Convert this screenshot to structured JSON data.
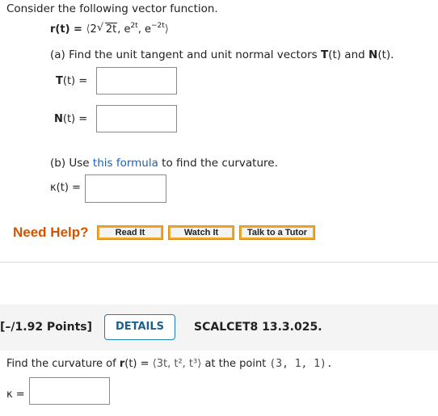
{
  "intro": "Consider the following vector function.",
  "vector_function": {
    "lhs": "r(t) = ",
    "open": "⟨",
    "coef": "2",
    "radical": "√",
    "radicand": "2t",
    "after_sqrt": ", e",
    "exp1": "2t",
    "sep": ", e",
    "exp2": "−2t",
    "close": "⟩"
  },
  "part_a": {
    "prefix": "(a) Find the unit tangent and unit normal vectors ",
    "T": "T",
    "T_arg": "(t)",
    "and": " and ",
    "N": "N",
    "N_arg": "(t)",
    "end": ".",
    "T_label_bold": "T",
    "T_label_rest": "(t)  =",
    "N_label_bold": "N",
    "N_label_rest": "(t)  ="
  },
  "part_b": {
    "prefix": "(b) Use ",
    "link": "this formula",
    "suffix": " to find the curvature.",
    "kappa_label": "κ(t)  ="
  },
  "help": {
    "label": "Need Help?",
    "buttons": [
      "Read It",
      "Watch It",
      "Talk to a Tutor"
    ]
  },
  "question2": {
    "points": "[–/1.92 Points]",
    "details": "DETAILS",
    "source": "SCALCET8 13.3.025.",
    "text_prefix": "Find the curvature of ",
    "r_bold": "r",
    "r_rest": "(t) = ",
    "vec": "⟨3t, t², t³⟩",
    "at_point": " at the point ",
    "point": "(3, 1, 1).",
    "kappa_label": "κ ="
  }
}
